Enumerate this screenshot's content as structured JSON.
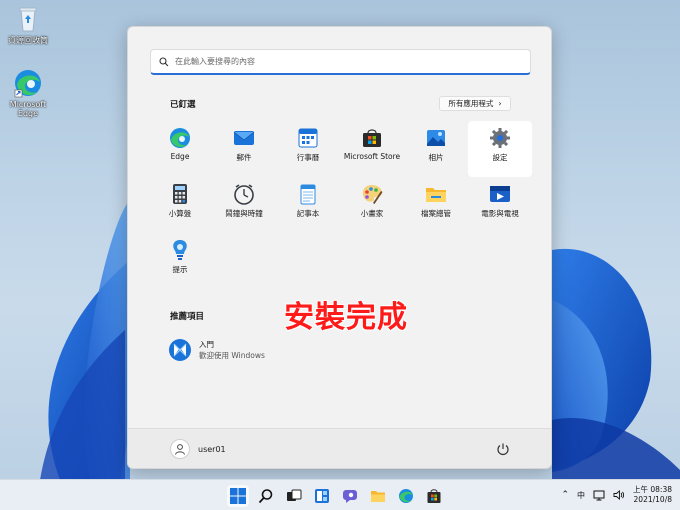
{
  "desktop": {
    "recycle_bin": "資源回收筒",
    "edge": "Microsoft Edge"
  },
  "start": {
    "search_placeholder": "在此輸入要搜尋的內容",
    "pinned_title": "已釘選",
    "all_apps_label": "所有應用程式",
    "pinned_apps": [
      {
        "label": "Edge",
        "icon": "edge-icon"
      },
      {
        "label": "郵件",
        "icon": "mail-icon"
      },
      {
        "label": "行事曆",
        "icon": "calendar-icon"
      },
      {
        "label": "Microsoft Store",
        "icon": "store-icon"
      },
      {
        "label": "相片",
        "icon": "photos-icon"
      },
      {
        "label": "設定",
        "icon": "settings-icon"
      },
      {
        "label": "小算盤",
        "icon": "calculator-icon"
      },
      {
        "label": "鬧鐘與時鐘",
        "icon": "clock-icon"
      },
      {
        "label": "記事本",
        "icon": "notepad-icon"
      },
      {
        "label": "小畫家",
        "icon": "paint-icon"
      },
      {
        "label": "檔案總管",
        "icon": "folder-icon"
      },
      {
        "label": "電影與電視",
        "icon": "movies-icon"
      },
      {
        "label": "提示",
        "icon": "tips-icon"
      }
    ],
    "recommended_title": "推薦項目",
    "recommended": [
      {
        "title": "入門",
        "subtitle": "歡迎使用 Windows",
        "icon": "get-started-icon"
      }
    ],
    "overlay": "安裝完成",
    "user_name": "user01"
  },
  "taskbar": {
    "ime": "中",
    "time": "上午 08:38",
    "date": "2021/10/8"
  }
}
